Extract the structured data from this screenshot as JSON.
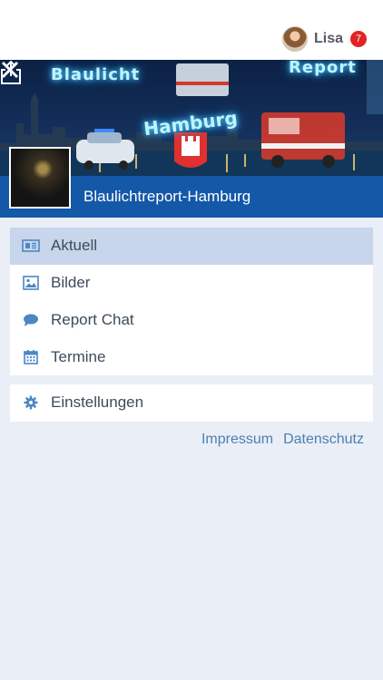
{
  "user": {
    "name": "Lisa",
    "notification_count": "7"
  },
  "banner": {
    "left_text": "Blaulicht",
    "right_text": "Report",
    "center_text": "Hamburg"
  },
  "channel": {
    "name": "Blaulichtreport-Hamburg"
  },
  "menu": {
    "items": [
      {
        "label": "Aktuell",
        "icon": "newspaper-icon",
        "active": true
      },
      {
        "label": "Bilder",
        "icon": "image-icon",
        "active": false
      },
      {
        "label": "Report Chat",
        "icon": "chat-bubble-icon",
        "active": false
      },
      {
        "label": "Termine",
        "icon": "calendar-icon",
        "active": false
      }
    ],
    "settings": {
      "label": "Einstellungen",
      "icon": "gear-icon"
    }
  },
  "footer_links": {
    "impressum": "Impressum",
    "datenschutz": "Datenschutz"
  },
  "colors": {
    "accent": "#1458a8",
    "icon": "#4d86c4",
    "active_row": "#c7d6ea",
    "badge": "#e02424",
    "link": "#4d7fb1"
  }
}
